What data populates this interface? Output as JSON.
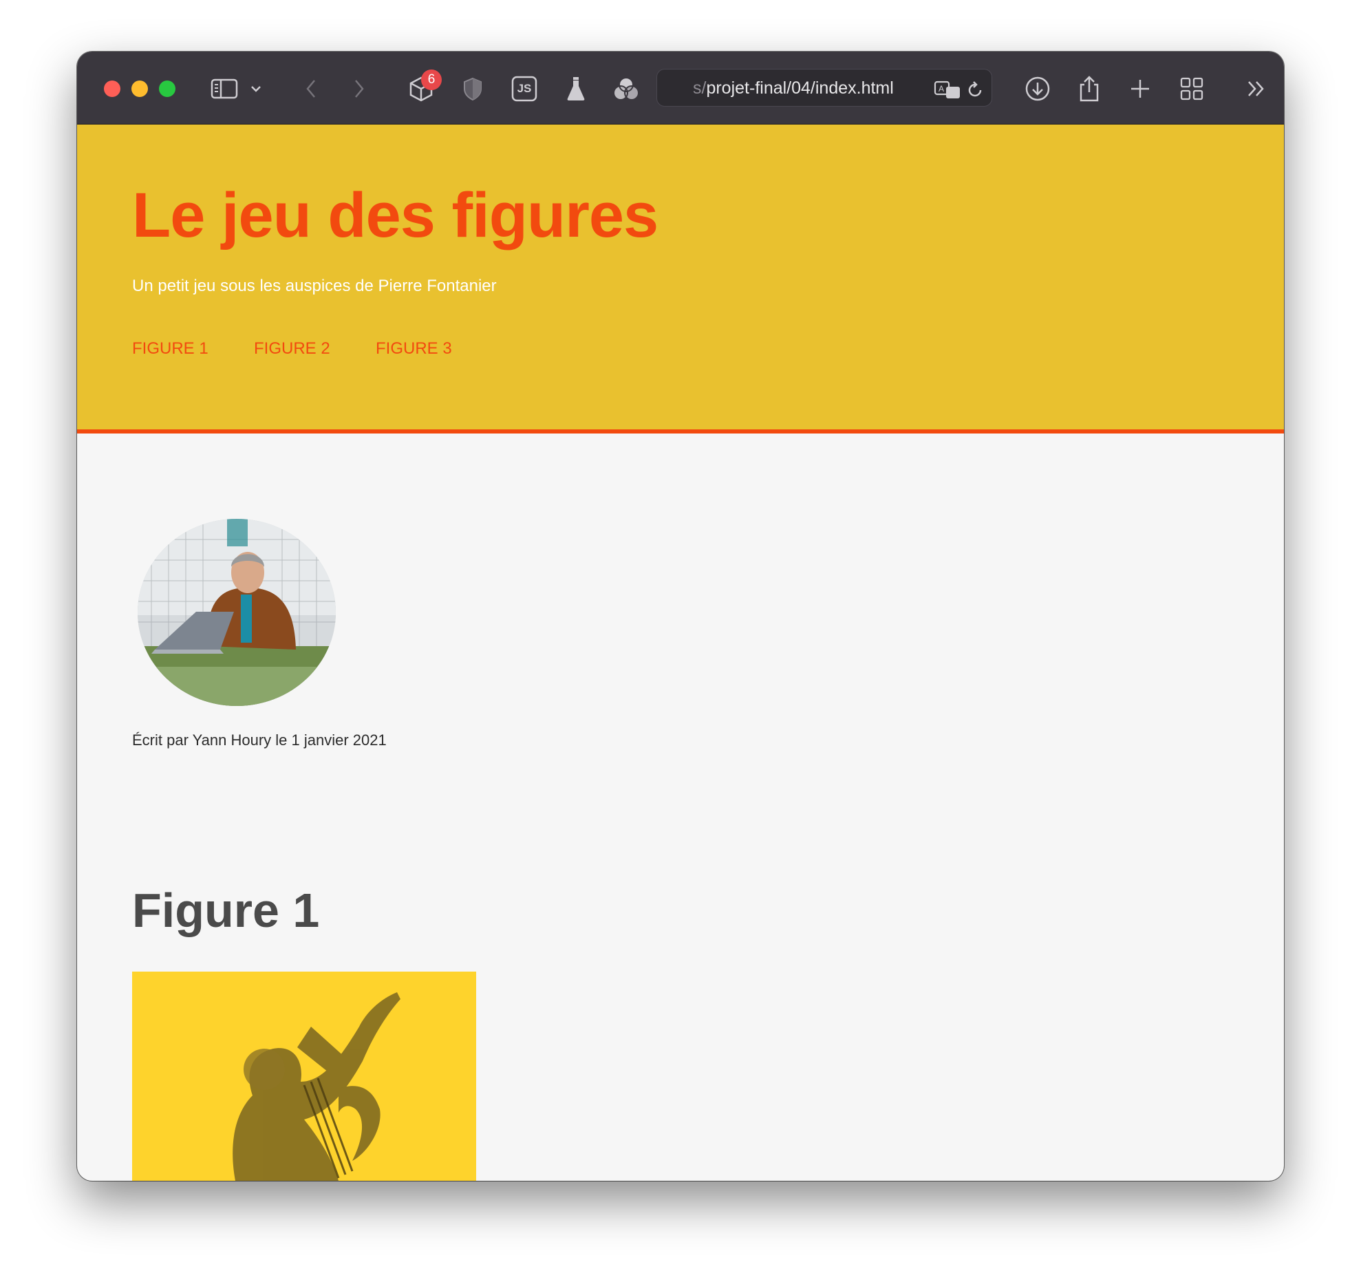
{
  "browser": {
    "url_prefix": "s/",
    "url_path": "projet-final/04/index.html",
    "extension_badge": "6",
    "js_label": "JS"
  },
  "header": {
    "title": "Le jeu des figures",
    "subtitle": "Un petit jeu sous les auspices de Pierre Fontanier",
    "nav": [
      "FIGURE 1",
      "FIGURE 2",
      "FIGURE 3"
    ]
  },
  "content": {
    "byline": "Écrit par Yann Houry le 1 janvier 2021",
    "section_title": "Figure 1"
  },
  "colors": {
    "header_bg": "#e9c12f",
    "accent": "#f24a0f",
    "page_bg": "#f6f6f6",
    "figure_bg": "#fed32c",
    "toolbar_bg": "#3a373e"
  }
}
